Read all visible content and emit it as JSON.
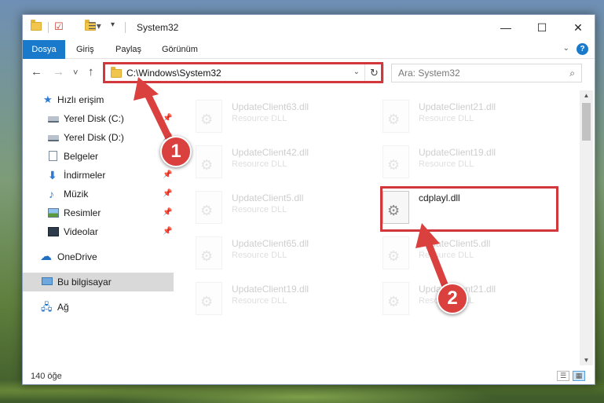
{
  "window": {
    "title": "System32",
    "controls": {
      "minimize": "—",
      "maximize": "☐",
      "close": "✕"
    }
  },
  "ribbon": {
    "tabs": [
      "Dosya",
      "Giriş",
      "Paylaş",
      "Görünüm"
    ],
    "help": "?"
  },
  "nav": {
    "back": "←",
    "forward": "→",
    "recent": "˅",
    "up": "↑",
    "address": "C:\\Windows\\System32",
    "refresh": "↻",
    "search_placeholder": "Ara: System32"
  },
  "sidebar": {
    "items": [
      {
        "label": "Hızlı erişim",
        "icon": "star-icon"
      },
      {
        "label": "Yerel Disk (C:)",
        "icon": "disk-icon",
        "pinned": true
      },
      {
        "label": "Yerel Disk (D:)",
        "icon": "disk-icon",
        "pinned": true
      },
      {
        "label": "Belgeler",
        "icon": "document-icon",
        "pinned": true
      },
      {
        "label": "İndirmeler",
        "icon": "download-icon",
        "pinned": true
      },
      {
        "label": "Müzik",
        "icon": "music-icon",
        "pinned": true
      },
      {
        "label": "Resimler",
        "icon": "picture-icon",
        "pinned": true
      },
      {
        "label": "Videolar",
        "icon": "video-icon",
        "pinned": true
      },
      {
        "label": "OneDrive",
        "icon": "cloud-icon"
      },
      {
        "label": "Bu bilgisayar",
        "icon": "computer-icon",
        "selected": true
      },
      {
        "label": "Ağ",
        "icon": "network-icon"
      }
    ]
  },
  "files": [
    {
      "name": "UpdateClient63.dll",
      "type": "Resource DLL"
    },
    {
      "name": "UpdateClient21.dll",
      "type": "Resource DLL"
    },
    {
      "name": "UpdateClient42.dll",
      "type": "Resource DLL"
    },
    {
      "name": "UpdateClient19.dll",
      "type": "Resource DLL"
    },
    {
      "name": "UpdateClient5.dll",
      "type": "Resource DLL"
    },
    {
      "name": "cdplayl.dll",
      "type": "",
      "highlighted": true
    },
    {
      "name": "UpdateClient65.dll",
      "type": "Resource DLL"
    },
    {
      "name": "UpdateClient5.dll",
      "type": "Resource DLL"
    },
    {
      "name": "UpdateClient19.dll",
      "type": "Resource DLL"
    },
    {
      "name": "UpdateClient21.dll",
      "type": "Resource DLL"
    }
  ],
  "status": {
    "count": "140 öğe"
  },
  "annotations": {
    "step1": "1",
    "step2": "2",
    "color": "#d2373c"
  }
}
